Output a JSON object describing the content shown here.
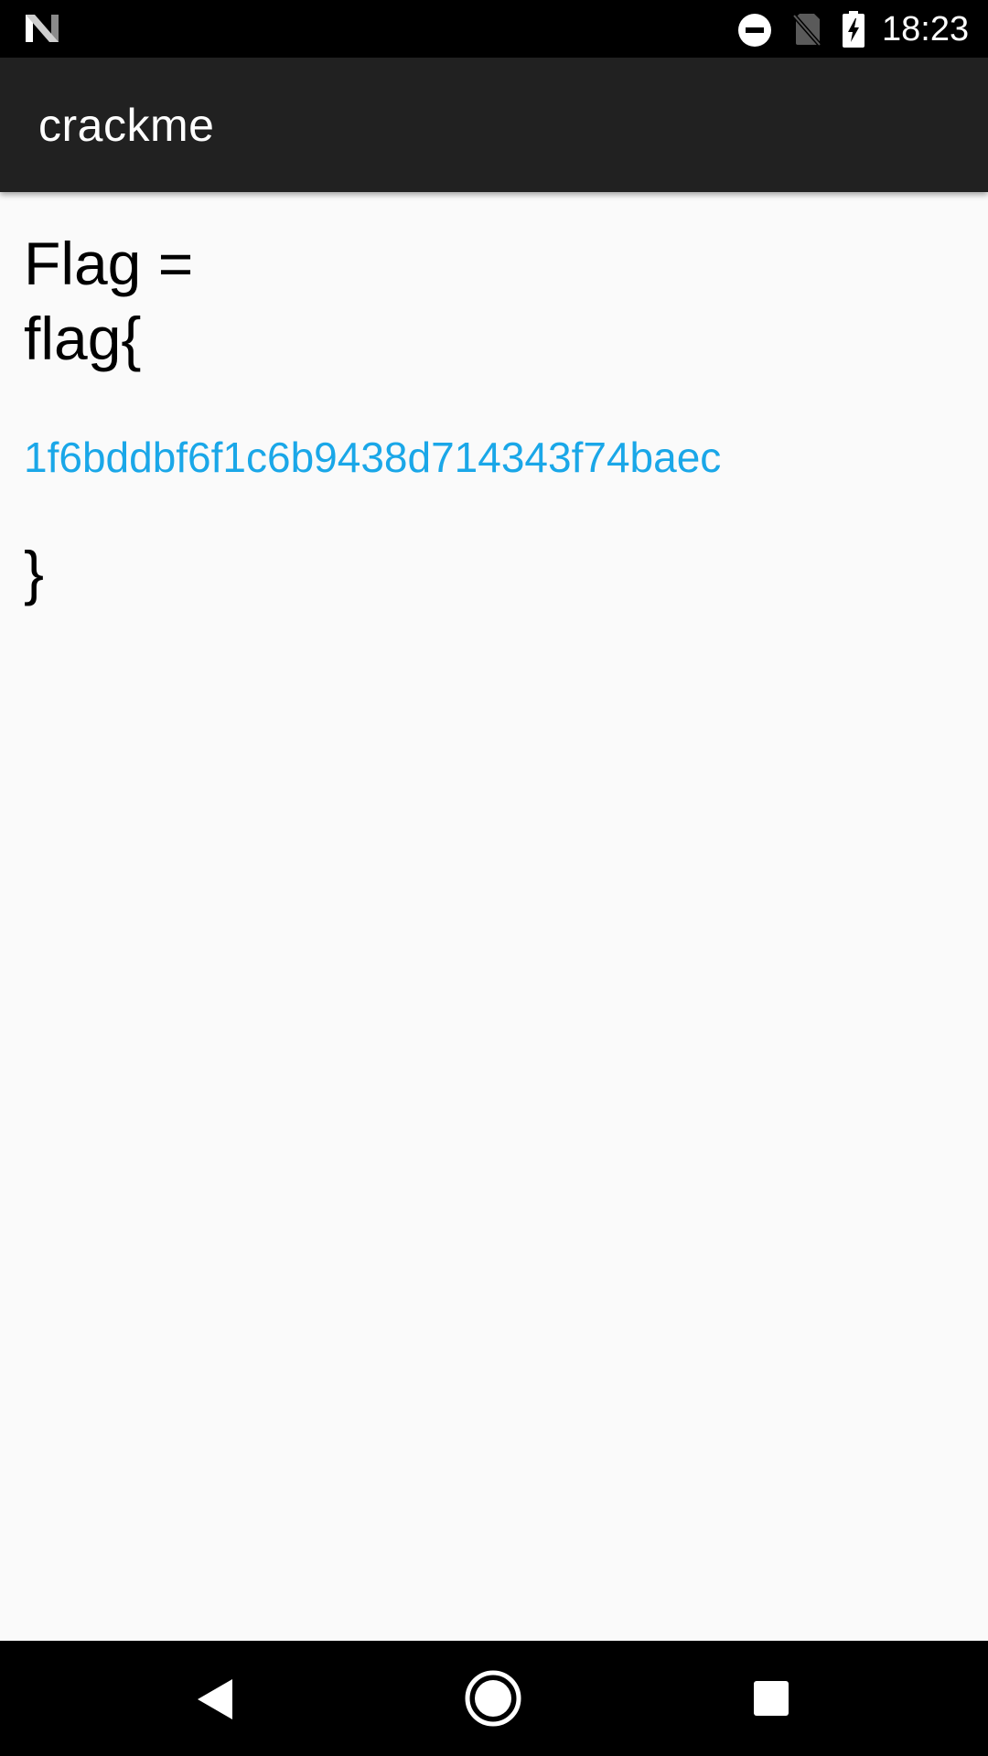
{
  "status_bar": {
    "time": "18:23",
    "icons": [
      "n-logo-icon",
      "do-not-disturb-icon",
      "no-sim-icon",
      "battery-charging-icon"
    ]
  },
  "app_bar": {
    "title": "crackme"
  },
  "content": {
    "flag_label": "Flag =",
    "flag_open": "flag{",
    "flag_value": "1f6bddbf6f1c6b9438d714343f74baec",
    "flag_close": "}"
  },
  "nav_bar": {
    "icons": [
      "back-icon",
      "home-icon",
      "recents-icon"
    ]
  },
  "colors": {
    "status_bar": "#000000",
    "app_bar": "#212121",
    "background": "#fafafa",
    "flag_value": "#1aa7e8",
    "text": "#000000"
  }
}
